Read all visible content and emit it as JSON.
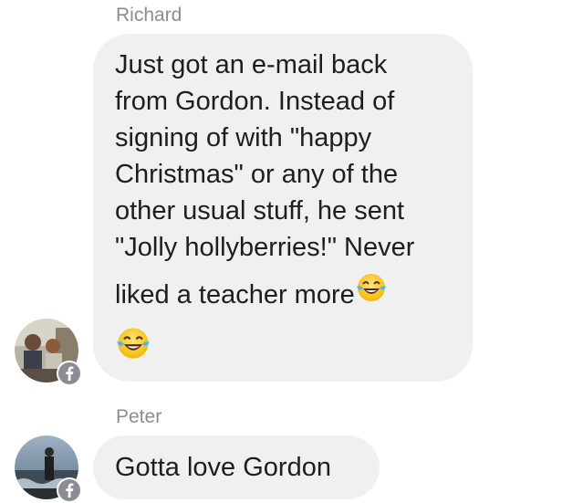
{
  "conversation": {
    "messages": [
      {
        "sender": "Richard",
        "lines": [
          "Just got an e-mail back",
          "from Gordon. Instead of",
          "signing of with \"happy",
          "Christmas\" or any of the",
          "other usual stuff, he sent",
          "\"Jolly hollyberries!\" Never",
          "liked a teacher more"
        ],
        "trailing_emoji": "tears-of-joy-emoji",
        "extra_emoji": "tears-of-joy-emoji",
        "avatar": "richard-avatar",
        "badge": "facebook-icon"
      },
      {
        "sender": "Peter",
        "lines": [
          "Gotta love Gordon"
        ],
        "avatar": "peter-avatar",
        "badge": "facebook-icon"
      }
    ]
  },
  "colors": {
    "bubble": "#f0f0f0",
    "sender_name": "#8a8d91",
    "text": "#1c1e21",
    "badge": "#8a8d91"
  }
}
